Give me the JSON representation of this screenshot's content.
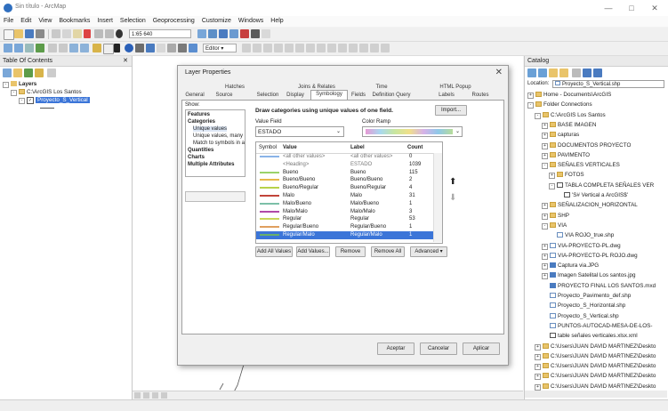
{
  "window": {
    "title": "Sin título - ArcMap"
  },
  "menu": [
    "File",
    "Edit",
    "View",
    "Bookmarks",
    "Insert",
    "Selection",
    "Geoprocessing",
    "Customize",
    "Windows",
    "Help"
  ],
  "toolbar": {
    "scale": "1:65 640",
    "editor_label": "Editor ▾"
  },
  "toc": {
    "header": "Table Of Contents",
    "items": {
      "layers": "Layers",
      "folder": "C:\\ArcGIS Los Santos",
      "layer": "Proyecto_S_Vertical"
    }
  },
  "dialog": {
    "title": "Layer Properties",
    "tabs_row1": [
      "Hatches",
      "Joins & Relates",
      "Time",
      "HTML Popup"
    ],
    "tabs_row2": [
      "General",
      "Source",
      "Selection",
      "Display",
      "Symbology",
      "Fields",
      "Definition Query",
      "Labels",
      "Routes"
    ],
    "active_tab": "Symbology",
    "show_label": "Show:",
    "show_items": [
      "Features",
      "Categories",
      "Unique values",
      "Unique values, many",
      "Match to symbols in a",
      "Quantities",
      "Charts",
      "Multiple Attributes"
    ],
    "heading": "Draw categories using unique values of one field.",
    "import_label": "Import...",
    "value_field_label": "Value Field",
    "value_field": "ESTADO",
    "color_ramp_label": "Color Ramp",
    "columns": [
      "Symbol",
      "Value",
      "Label",
      "Count"
    ],
    "rows": [
      {
        "value": "<all other values>",
        "label": "<all other values>",
        "count": "0",
        "color": "#8ab4e8",
        "style": "dim"
      },
      {
        "value": "<Heading>",
        "label": "ESTADO",
        "count": "1039",
        "color": "",
        "style": "dim"
      },
      {
        "value": "Bueno",
        "label": "Bueno",
        "count": "115",
        "color": "#9bd36a"
      },
      {
        "value": "Bueno/Bueno",
        "label": "Bueno/Bueno",
        "count": "2",
        "color": "#e6b84a"
      },
      {
        "value": "Bueno/Regular",
        "label": "Bueno/Regular",
        "count": "4",
        "color": "#b8d24a"
      },
      {
        "value": "Malo",
        "label": "Malo",
        "count": "31",
        "color": "#c2443a"
      },
      {
        "value": "Malo/Bueno",
        "label": "Malo/Bueno",
        "count": "1",
        "color": "#7cc0a8"
      },
      {
        "value": "Malo/Malo",
        "label": "Malo/Malo",
        "count": "3",
        "color": "#b04aa8"
      },
      {
        "value": "Regular",
        "label": "Regular",
        "count": "53",
        "color": "#c8d65a"
      },
      {
        "value": "Regular/Bueno",
        "label": "Regular/Bueno",
        "count": "1",
        "color": "#e0a060"
      },
      {
        "value": "Regular/Malo",
        "label": "Regular/Malo",
        "count": "1",
        "color": "#6ab06a",
        "style": "sel"
      }
    ],
    "buttons": [
      "Add All Values",
      "Add Values...",
      "Remove",
      "Remove All",
      "Advanced ▾"
    ],
    "footer": [
      "Aceptar",
      "Cancelar",
      "Aplicar"
    ]
  },
  "catalog": {
    "header": "Catalog",
    "location_label": "Location:",
    "location": "Proyecto_S_Vertical.shp",
    "tree": [
      {
        "text": "Home - Documents\\ArcGIS",
        "indent": 0,
        "icon": "folder",
        "exp": "+"
      },
      {
        "text": "Folder Connections",
        "indent": 0,
        "icon": "folder",
        "exp": "-"
      },
      {
        "text": "C:\\ArcGIS Los Santos",
        "indent": 1,
        "icon": "folder",
        "exp": "-"
      },
      {
        "text": "BASE IMAGEN",
        "indent": 2,
        "icon": "folder",
        "exp": "+"
      },
      {
        "text": "capturas",
        "indent": 2,
        "icon": "folder",
        "exp": "+"
      },
      {
        "text": "DOCUMENTOS PROYECTO",
        "indent": 2,
        "icon": "folder",
        "exp": "+"
      },
      {
        "text": "PAVIMENTO",
        "indent": 2,
        "icon": "folder",
        "exp": "+"
      },
      {
        "text": "SEÑALES VERTICALES",
        "indent": 2,
        "icon": "folder",
        "exp": "-"
      },
      {
        "text": "FOTOS",
        "indent": 3,
        "icon": "folder",
        "exp": "+"
      },
      {
        "text": "TABLA COMPLETA SEÑALES VER",
        "indent": 3,
        "icon": "table",
        "exp": "-"
      },
      {
        "text": "'S# Vertical a ArcGIS$'",
        "indent": 4,
        "icon": "table",
        "exp": ""
      },
      {
        "text": "SEÑALIZACION_HORIZONTAL",
        "indent": 2,
        "icon": "folder",
        "exp": "+"
      },
      {
        "text": "SHP",
        "indent": 2,
        "icon": "folder",
        "exp": "+"
      },
      {
        "text": "VIA",
        "indent": 2,
        "icon": "folder",
        "exp": "-"
      },
      {
        "text": "VIA ROJO_true.shp",
        "indent": 3,
        "icon": "shp",
        "exp": ""
      },
      {
        "text": "VIA-PROYECTO-PL.dwg",
        "indent": 2,
        "icon": "shp",
        "exp": "+"
      },
      {
        "text": "VIA-PROYECTO-PL ROJO.dwg",
        "indent": 2,
        "icon": "shp",
        "exp": "+"
      },
      {
        "text": "Captura via.JPG",
        "indent": 2,
        "icon": "map",
        "exp": "+"
      },
      {
        "text": "Imagen Satelital Los santos.jpg",
        "indent": 2,
        "icon": "map",
        "exp": "+"
      },
      {
        "text": "PROYECTO FINAL LOS SANTOS.mxd",
        "indent": 2,
        "icon": "map",
        "exp": ""
      },
      {
        "text": "Proyecto_Pavimento_def.shp",
        "indent": 2,
        "icon": "shp",
        "exp": ""
      },
      {
        "text": "Proyecto_S_Horizontal.shp",
        "indent": 2,
        "icon": "shp",
        "exp": ""
      },
      {
        "text": "Proyecto_S_Vertical.shp",
        "indent": 2,
        "icon": "shp",
        "exp": ""
      },
      {
        "text": "PUNTOS-AUTOCAD-MESA-DE-LOS-",
        "indent": 2,
        "icon": "shp",
        "exp": ""
      },
      {
        "text": "table señales verticales.xlsx.xml",
        "indent": 2,
        "icon": "table",
        "exp": ""
      },
      {
        "text": "C:\\Users\\JUAN DAVID MARTINEZ\\Deskto",
        "indent": 1,
        "icon": "folder",
        "exp": "+"
      },
      {
        "text": "C:\\Users\\JUAN DAVID MARTINEZ\\Deskto",
        "indent": 1,
        "icon": "folder",
        "exp": "+"
      },
      {
        "text": "C:\\Users\\JUAN DAVID MARTINEZ\\Deskto",
        "indent": 1,
        "icon": "folder",
        "exp": "+"
      },
      {
        "text": "C:\\Users\\JUAN DAVID MARTINEZ\\Deskto",
        "indent": 1,
        "icon": "folder",
        "exp": "+"
      },
      {
        "text": "C:\\Users\\JUAN DAVID MARTINEZ\\Deskto",
        "indent": 1,
        "icon": "folder",
        "exp": "+"
      }
    ]
  }
}
